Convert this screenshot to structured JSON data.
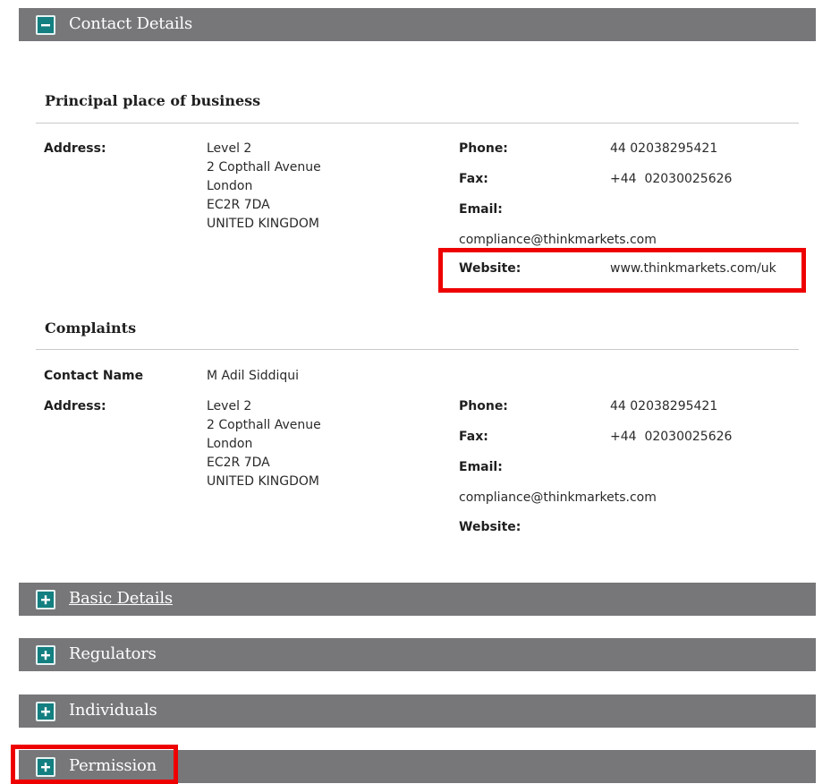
{
  "sections": {
    "contact": {
      "title": "Contact Details"
    },
    "basic": {
      "title": "Basic Details"
    },
    "regulators": {
      "title": "Regulators"
    },
    "individuals": {
      "title": "Individuals"
    },
    "permission": {
      "title": "Permission"
    }
  },
  "principal": {
    "heading": "Principal place of business",
    "address_label": "Address:",
    "address_lines": [
      "Level 2",
      "2 Copthall Avenue",
      "London",
      "EC2R 7DA",
      "UNITED KINGDOM"
    ],
    "phone_label": "Phone:",
    "phone": "44 02038295421",
    "fax_label": "Fax:",
    "fax": "+44  02030025626",
    "email_label": "Email:",
    "email": "compliance@thinkmarkets.com",
    "website_label": "Website:",
    "website": "www.thinkmarkets.com/uk"
  },
  "complaints": {
    "heading": "Complaints",
    "contact_label": "Contact Name",
    "contact_name": "M Adil Siddiqui",
    "address_label": "Address:",
    "address_lines": [
      "Level 2",
      "2 Copthall Avenue",
      "London",
      "EC2R 7DA",
      "UNITED KINGDOM"
    ],
    "phone_label": "Phone:",
    "phone": "44 02038295421",
    "fax_label": "Fax:",
    "fax": "+44  02030025626",
    "email_label": "Email:",
    "email": "compliance@thinkmarkets.com",
    "website_label": "Website:"
  },
  "icons": {
    "collapse": "minus-icon",
    "expand": "plus-icon"
  },
  "colors": {
    "header_bg": "#77777a",
    "toggle_bg": "#137f80",
    "highlight": "#ee0000"
  }
}
